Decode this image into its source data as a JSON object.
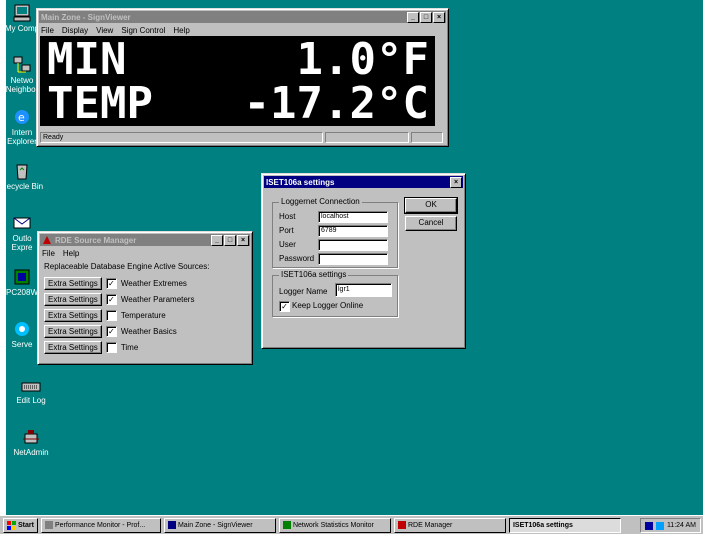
{
  "desktop": {
    "icons": [
      {
        "label": "My Comp",
        "icon": "computer-icon"
      },
      {
        "label": "Netwo\nNeighbor",
        "icon": "network-icon"
      },
      {
        "label": "Intern\nExplorer",
        "icon": "ie-icon"
      },
      {
        "label": "Recycle Bin",
        "icon": "recycle-bin-icon"
      },
      {
        "label": "Outlo\nExpre",
        "icon": "outlook-icon"
      },
      {
        "label": "PC208W",
        "icon": "pc208w-icon"
      },
      {
        "label": "Serve",
        "icon": "server-icon"
      },
      {
        "label": "Edit Log",
        "icon": "keyboard-icon"
      },
      {
        "label": "NetAdmin",
        "icon": "netadmin-icon"
      }
    ]
  },
  "signviewer": {
    "title": "Main Zone - SignViewer",
    "menu": [
      "File",
      "Display",
      "View",
      "Sign Control",
      "Help"
    ],
    "line1_left": "MIN",
    "line1_right": "1.0°F",
    "line2_left": "TEMP",
    "line2_right": "-17.2°C",
    "status": "Ready"
  },
  "rde": {
    "title": "RDE Source Manager",
    "menu": [
      "File",
      "Help"
    ],
    "heading": "Replaceable Database Engine Active Sources:",
    "button_label": "Extra Settings",
    "sources": [
      {
        "name": "Weather Extremes",
        "checked": "✓"
      },
      {
        "name": "Weather Parameters",
        "checked": "✓"
      },
      {
        "name": "Temperature",
        "checked": ""
      },
      {
        "name": "Weather Basics",
        "checked": "✓"
      },
      {
        "name": "Time",
        "checked": ""
      }
    ]
  },
  "iset": {
    "title": "ISET106a settings",
    "conn_group": "Loggernet Connection",
    "host_label": "Host",
    "host_value": "localhost",
    "port_label": "Port",
    "port_value": "6789",
    "user_label": "User",
    "user_value": "",
    "password_label": "Password",
    "password_value": "",
    "settings_group": "ISET106a settings",
    "logger_name_label": "Logger Name",
    "logger_name_value": "lgr1",
    "keep_online_label": "Keep Logger Online",
    "keep_online_checked": "✓",
    "ok": "OK",
    "cancel": "Cancel"
  },
  "taskbar": {
    "start": "Start",
    "items": [
      "Performance Monitor - Prof...",
      "Main Zone - SignViewer",
      "Network Statistics Monitor",
      "RDE Manager",
      "ISET106a settings"
    ],
    "clock": "11:24 AM"
  }
}
